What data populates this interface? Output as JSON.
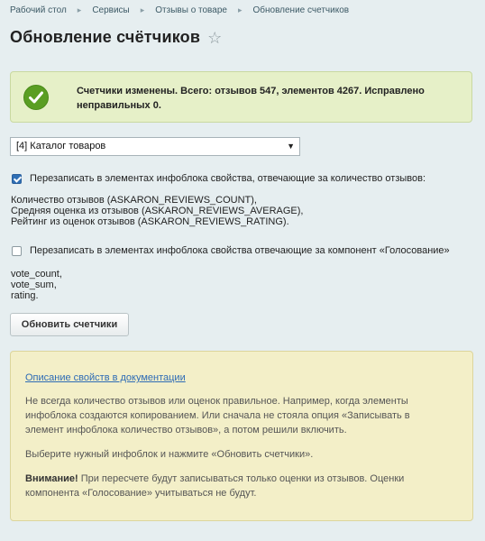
{
  "breadcrumb": [
    "Рабочий стол",
    "Сервисы",
    "Отзывы о товаре",
    "Обновление счетчиков"
  ],
  "page_title": "Обновление счётчиков",
  "success_message": "Счетчики изменены. Всего: отзывов 547, элементов 4267. Исправлено неправильных 0.",
  "iblock_select": {
    "selected": "[4] Каталог товаров"
  },
  "options": [
    {
      "checked": true,
      "label": "Перезаписать в элементах инфоблока свойства, отвечающие за количество отзывов:",
      "lines": [
        "Количество отзывов (ASKARON_REVIEWS_COUNT),",
        "Средняя оценка из отзывов (ASKARON_REVIEWS_AVERAGE),",
        "Рейтинг из оценок отзывов (ASKARON_REVIEWS_RATING)."
      ]
    },
    {
      "checked": false,
      "label": "Перезаписать в элементах инфоблока свойства отвечающие за компонент «Голосование»",
      "lines": [
        "vote_count,",
        "vote_sum,",
        "rating."
      ]
    }
  ],
  "submit_label": "Обновить счетчики",
  "note": {
    "link": "Описание свойств в документации",
    "p1": "Не всегда количество отзывов или оценок правильное. Например, когда элементы инфоблока создаются копированием. Или сначала не стояла опция «Записывать в элемент инфоблока количество отзывов», а потом решили включить.",
    "p2": "Выберите нужный инфоблок и нажмите «Обновить счетчики».",
    "p3_bold": "Внимание!",
    "p3_rest": " При пересчете будут записываться только оценки из отзывов. Оценки компонента «Голосование» учитываться не будут."
  },
  "colors": {
    "accent": "#2d6bb5",
    "success_icon": "#5a9e23"
  }
}
